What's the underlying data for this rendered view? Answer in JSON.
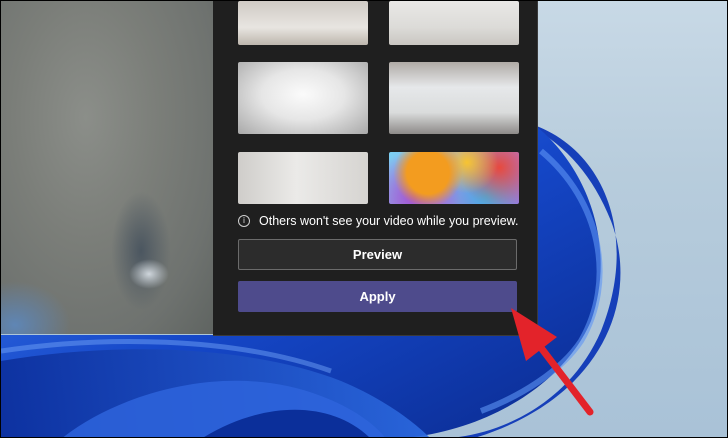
{
  "background_panel": {
    "notice": {
      "icon": "info-icon",
      "glyph": "i",
      "text": "Others won't see your video while you preview."
    },
    "buttons": {
      "preview_label": "Preview",
      "apply_label": "Apply"
    },
    "thumbnails": [
      {
        "name": "background-thumb-loft-entry"
      },
      {
        "name": "background-thumb-bright-room"
      },
      {
        "name": "background-thumb-white-bedroom"
      },
      {
        "name": "background-thumb-industrial-office"
      },
      {
        "name": "background-thumb-white-corner"
      },
      {
        "name": "background-thumb-colorful-abstract"
      }
    ]
  },
  "colors": {
    "panel_bg": "#1f1f1f",
    "apply_accent": "#4e4b8c",
    "annotation_arrow": "#e3232a",
    "wallpaper_blue": "#1746c9"
  }
}
